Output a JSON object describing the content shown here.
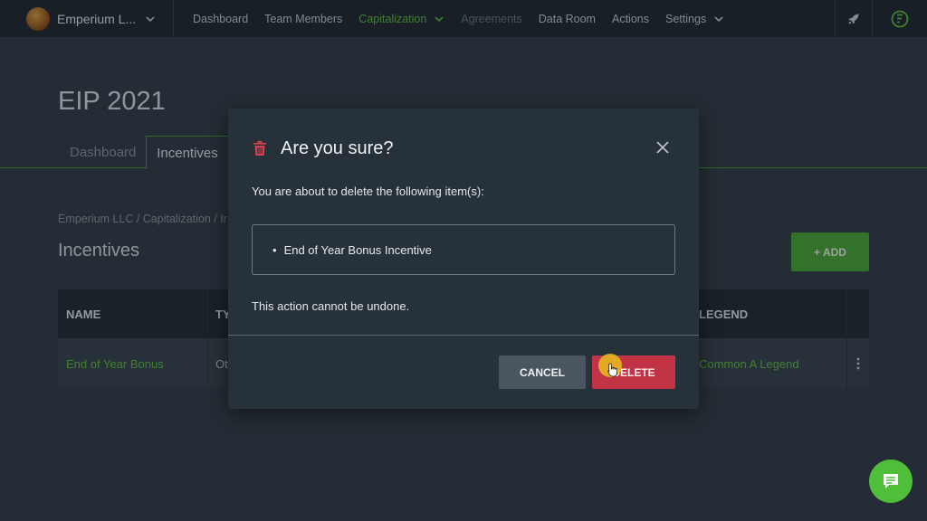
{
  "nav": {
    "company": "Emperium L...",
    "links": [
      "Dashboard",
      "Team Members",
      "Capitalization",
      "Agreements",
      "Data Room",
      "Actions",
      "Settings"
    ]
  },
  "page": {
    "title": "EIP 2021",
    "tabs": [
      "Dashboard",
      "Incentives"
    ],
    "breadcrumb": "Emperium LLC / Capitalization / Ir",
    "section_title": "Incentives",
    "add_label": "+ ADD"
  },
  "table": {
    "headers": [
      "NAME",
      "TY",
      "LEGEND"
    ],
    "rows": [
      {
        "name": "End of Year Bonus",
        "type": "Ot",
        "legend": "Common A Legend"
      }
    ]
  },
  "modal": {
    "title": "Are you sure?",
    "message": "You are about to delete the following item(s):",
    "items": [
      "End of Year Bonus Incentive"
    ],
    "warning": "This action cannot be undone.",
    "cancel_label": "CANCEL",
    "delete_label": "DELETE"
  },
  "colors": {
    "accent": "#4aa832",
    "danger": "#c23345",
    "background": "#2f3a44"
  },
  "icons": [
    "chevron-down-icon",
    "rocket-icon",
    "f-badge-icon",
    "trash-icon",
    "close-icon",
    "more-vertical-icon",
    "chat-icon"
  ]
}
